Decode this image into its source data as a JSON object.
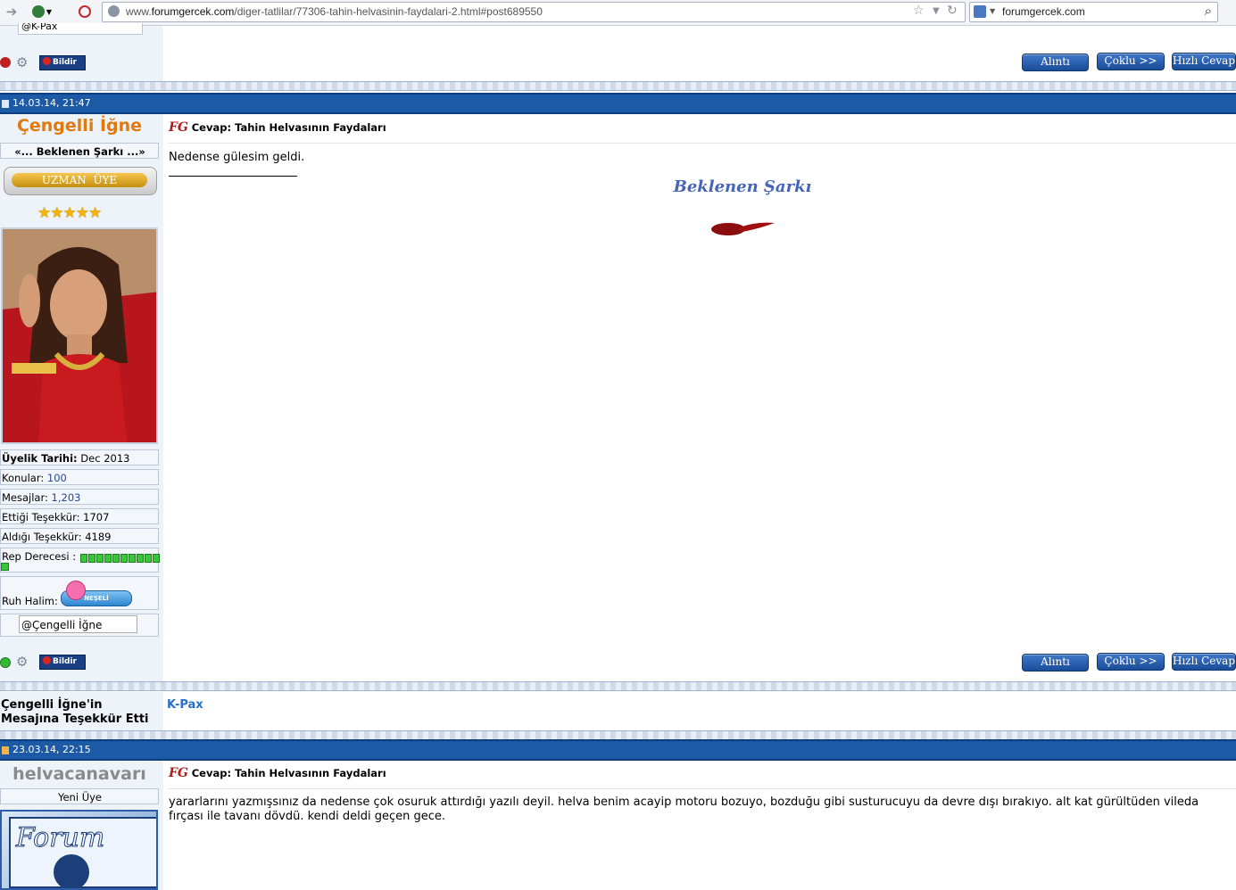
{
  "browser": {
    "url_prefix": "www.",
    "url_domain": "forumgercek.com",
    "url_path": "/diger-tatlilar/77306-tahin-helvasinin-faydalari-2.html#post689550",
    "search_text": "forumgercek.com"
  },
  "buttons": {
    "quote": "Alıntı",
    "multi_quote": "Çoklu >>",
    "quick_reply": "Hızlı Cevap",
    "report": "Bildir"
  },
  "prev_post": {
    "signature_value": "@K-Pax"
  },
  "post1": {
    "date": "14.03.14, 21:47",
    "username": "Çengelli İğne",
    "user_title": "«... Beklenen Şarkı ...»",
    "rank_badge": "UZMAN  ÜYE",
    "stars": 5,
    "join_label": "Üyelik Tarihi:",
    "join_value": "Dec 2013",
    "topics_label": "Konular:",
    "topics_value": "100",
    "messages_label": "Mesajlar:",
    "messages_value": "1,203",
    "thanks_given_label": "Ettiği Teşekkür:",
    "thanks_given_value": "1707",
    "thanks_received_label": "Aldığı Teşekkür:",
    "thanks_received_value": "4189",
    "rep_label": "Rep Derecesi :",
    "rep_blocks": 11,
    "mood_label": "Ruh Halim:",
    "mood_value": "NEŞELİ",
    "signature_value": "@Çengelli İğne",
    "title_prefix": "Cevap:",
    "title": "Tahin Helvasının Faydaları",
    "body": "Nedense gülesim geldi.",
    "signature_text": "Beklenen Şarkı"
  },
  "thanks": {
    "line1": "Çengelli İğne'in",
    "line2": "Mesajına Teşekkür Etti",
    "thanker": "K-Pax"
  },
  "post2": {
    "date": "23.03.14, 22:15",
    "username": "helvacanavarı",
    "user_title": "Yeni Üye",
    "avatar_text": "Forum",
    "title_prefix": "Cevap:",
    "title": "Tahin Helvasının Faydaları",
    "body": "yararlarını yazmışsınız da nedense çok osuruk attırdığı yazılı deyil. helva benim acayip motoru bozuyo, bozduğu gibi susturucuyu da devre dışı bırakıyo. alt kat gürültüden vileda fırçası ile tavanı dövdü. kendi deldi geçen gece."
  },
  "colors": {
    "date_bar": "#1d5aa5",
    "username_orange": "#e07a10",
    "link_blue": "#2a6fc7",
    "signature_blue": "#4665b8",
    "button_blue": "#2a5fb0"
  }
}
